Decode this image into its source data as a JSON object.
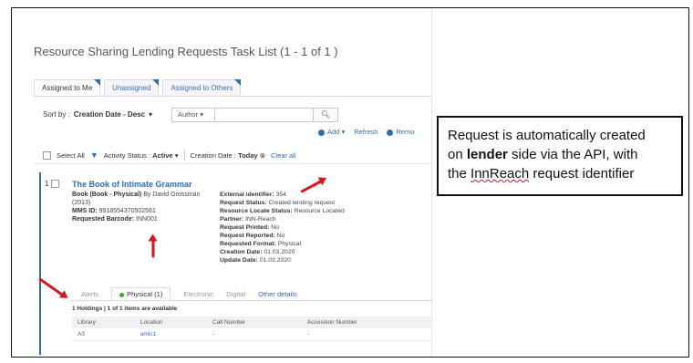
{
  "page_title": "Resource Sharing Lending Requests Task List (1 - 1 of 1 )",
  "tabs": [
    {
      "label": "Assigned to Me"
    },
    {
      "label": "Unassigned"
    },
    {
      "label": "Assigned to Others"
    }
  ],
  "sort": {
    "prefix": "Sort by :",
    "value": "Creation Date - Desc"
  },
  "search": {
    "field_selector": "Author",
    "query": ""
  },
  "actions": {
    "add": "Add",
    "refresh": "Refresh",
    "remove": "Remo"
  },
  "filters": {
    "select_all": "Select All",
    "activity_status_label": "Activity Status :",
    "activity_status_value": "Active",
    "creation_date_label": "Creation Date :",
    "creation_date_value": "Today",
    "clear_all": "Clear all"
  },
  "record": {
    "number": "1",
    "title": "The Book of Intimate Grammar",
    "format_label": "Book (Book - Physical)",
    "author": "By David Grossman (2013)",
    "mms_label": "MMS ID:",
    "mms_value": "9918554370502561",
    "barcode_label": "Requested Barcode:",
    "barcode_value": "INN001",
    "details": [
      {
        "label": "External identifier:",
        "value": "354"
      },
      {
        "label": "Request Status:",
        "value": "Created lending request"
      },
      {
        "label": "Resource Locate Status:",
        "value": "Resource Located"
      },
      {
        "label": "Partner:",
        "value": "INN-Reach"
      },
      {
        "label": "Request Printed:",
        "value": "No"
      },
      {
        "label": "Request Reported:",
        "value": "No"
      },
      {
        "label": "Requested Format:",
        "value": "Physical"
      },
      {
        "label": "Creation Date:",
        "value": "01.03.2020"
      },
      {
        "label": "Update Date:",
        "value": "01.03.2020"
      }
    ],
    "subtabs": [
      "Alerts",
      "Physical (1)",
      "Electronic",
      "Digital",
      "Other details"
    ],
    "holdings_summary": "1 Holdings | 1 of 1 items are available",
    "holdings_columns": [
      "Library",
      "Location",
      "Call Number",
      "Accession Number"
    ],
    "holdings_rows": [
      [
        "A3",
        "amlc1",
        "-",
        "-"
      ]
    ]
  },
  "callout": {
    "line1": "Request is automatically created",
    "line2_pre": "on ",
    "line2_bold": "lender",
    "line2_post": " side via the API, with",
    "line3_pre": "the ",
    "line3_squiggle": "InnReach",
    "line3_post": " request identifier"
  },
  "colors": {
    "accent": "#2d6db5",
    "annotation_arrow": "#d9161c"
  }
}
